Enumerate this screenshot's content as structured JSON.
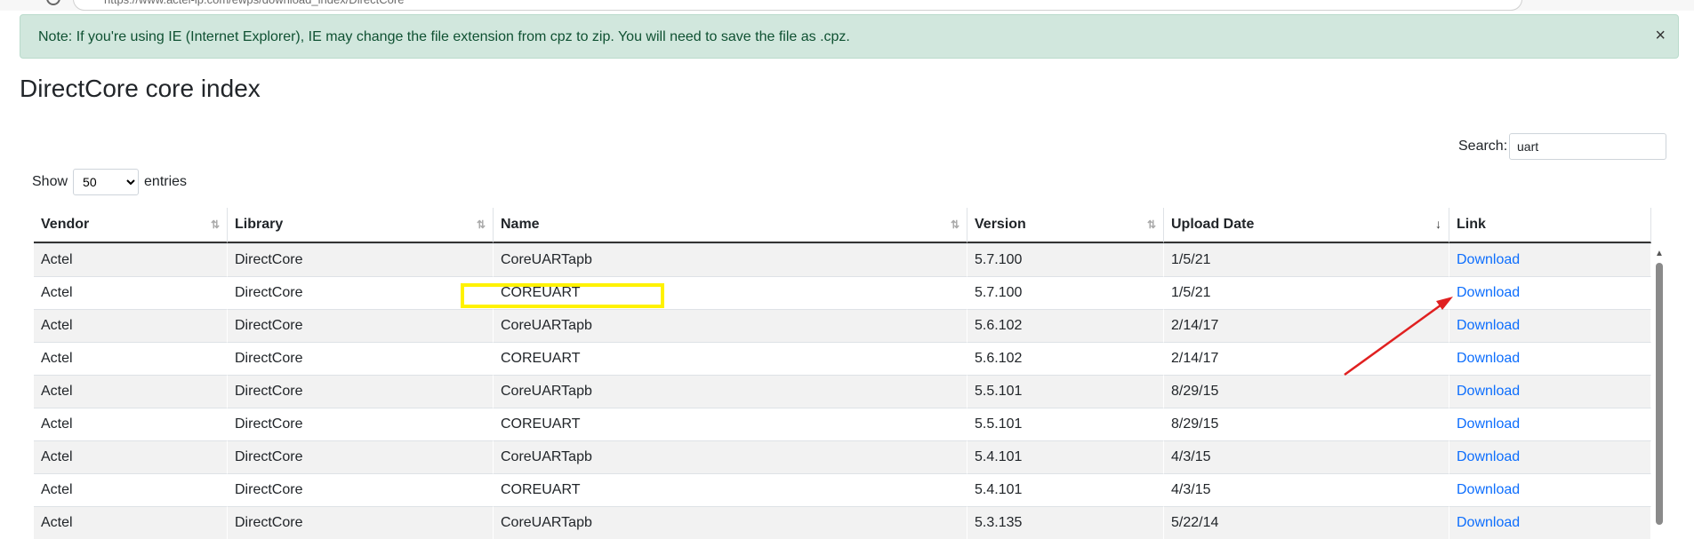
{
  "browser": {
    "url": "https://www.actel-ip.com/ewps/download_index/DirectCore"
  },
  "alert": {
    "message": "Note: If you're using IE (Internet Explorer), IE may change the file extension from cpz to zip. You will need to save the file as .cpz.",
    "close_label": "×"
  },
  "page_title": "DirectCore core index",
  "search": {
    "label": "Search:",
    "value": "uart"
  },
  "show_entries": {
    "prefix": "Show",
    "selected": "50",
    "suffix": "entries"
  },
  "table": {
    "columns": [
      "Vendor",
      "Library",
      "Name",
      "Version",
      "Upload Date",
      "Link"
    ],
    "sort_icons": {
      "inactive": "⇅",
      "active_desc": "↓"
    },
    "rows": [
      [
        "Actel",
        "DirectCore",
        "CoreUARTapb",
        "5.7.100",
        "1/5/21",
        "Download"
      ],
      [
        "Actel",
        "DirectCore",
        "COREUART",
        "5.7.100",
        "1/5/21",
        "Download"
      ],
      [
        "Actel",
        "DirectCore",
        "CoreUARTapb",
        "5.6.102",
        "2/14/17",
        "Download"
      ],
      [
        "Actel",
        "DirectCore",
        "COREUART",
        "5.6.102",
        "2/14/17",
        "Download"
      ],
      [
        "Actel",
        "DirectCore",
        "CoreUARTapb",
        "5.5.101",
        "8/29/15",
        "Download"
      ],
      [
        "Actel",
        "DirectCore",
        "COREUART",
        "5.5.101",
        "8/29/15",
        "Download"
      ],
      [
        "Actel",
        "DirectCore",
        "CoreUARTapb",
        "5.4.101",
        "4/3/15",
        "Download"
      ],
      [
        "Actel",
        "DirectCore",
        "COREUART",
        "5.4.101",
        "4/3/15",
        "Download"
      ],
      [
        "Actel",
        "DirectCore",
        "CoreUARTapb",
        "5.3.135",
        "5/22/14",
        "Download"
      ]
    ]
  },
  "colors": {
    "alert_bg": "#d1e7dd",
    "alert_text": "#0f5132",
    "link": "#0d6efd",
    "highlight": "#fff200",
    "arrow": "#e02020"
  }
}
